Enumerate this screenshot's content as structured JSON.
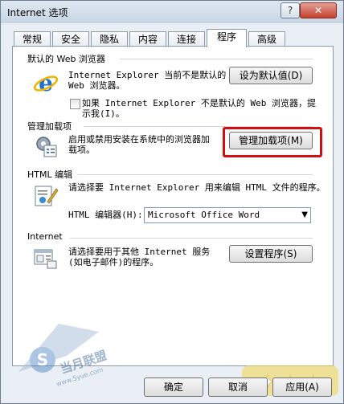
{
  "window": {
    "title": "Internet 选项",
    "help_label": "?",
    "close_label": "✕"
  },
  "tabs": [
    {
      "label": "常规"
    },
    {
      "label": "安全"
    },
    {
      "label": "隐私"
    },
    {
      "label": "内容"
    },
    {
      "label": "连接"
    },
    {
      "label": "程序",
      "active": true
    },
    {
      "label": "高级"
    }
  ],
  "default_browser": {
    "title": "默认的 Web 浏览器",
    "description_line1": "Internet Explorer 当前不是默认的",
    "description_line2": "Web 浏览器。",
    "button": "设为默认值(D)",
    "checkbox_line1": "如果 Internet Explorer 不是默认的 Web 浏览器，提",
    "checkbox_line2": "示我(I)。",
    "checkbox_checked": false
  },
  "addons": {
    "title": "管理加载项",
    "description_line1": "启用或禁用安装在系统中的浏览器加",
    "description_line2": "载项。",
    "button": "管理加载项(M)"
  },
  "html_editing": {
    "title": "HTML 编辑",
    "description": "请选择要 Internet Explorer 用来编辑 HTML 文件的程序。",
    "editor_label": "HTML 编辑器(H):",
    "editor_value": "Microsoft Office Word"
  },
  "internet_programs": {
    "title": "Internet",
    "description_line1": "请选择要用于其他 Internet 服务",
    "description_line2": "(如电子邮件)的程序。",
    "button": "设置程序(S)"
  },
  "footer": {
    "ok": "确定",
    "cancel": "取消",
    "apply": "应用(A)"
  },
  "watermark": {
    "text": "当月联盟",
    "url": "www.5yue.com"
  },
  "colors": {
    "highlight": "#d01010",
    "window_bg": "#e9eff5"
  }
}
